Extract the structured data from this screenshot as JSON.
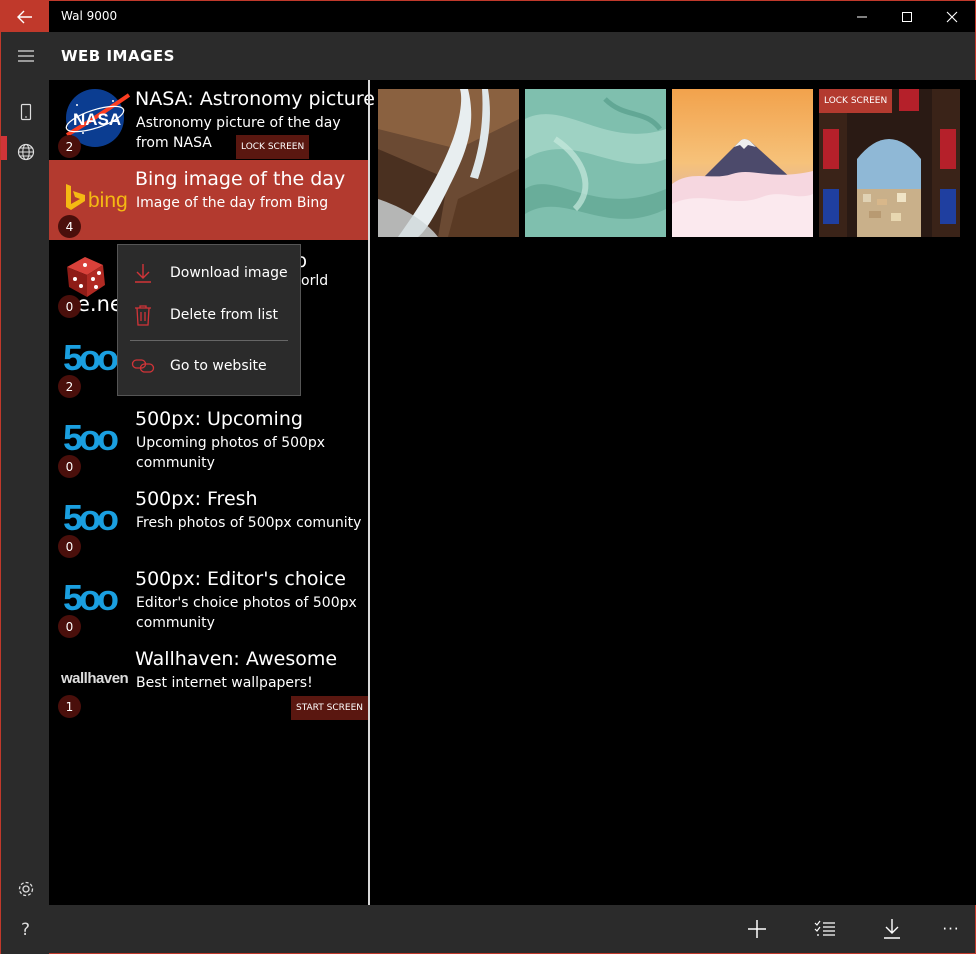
{
  "window": {
    "title": "Wal 9000"
  },
  "header": {
    "title": "WEB IMAGES"
  },
  "sources": [
    {
      "title": "NASA: Astronomy picture",
      "subtitle": "Astronomy picture of the day from NASA",
      "count": "2",
      "logo": "NASA"
    },
    {
      "title": "Bing image of the day",
      "subtitle": "Image of the day from Bing",
      "count": "4",
      "tag": "LOCK SCREEN",
      "logo": "bing",
      "selected": true
    },
    {
      "title_fragment": "p",
      "subtitle_fragment": "orld",
      "logo_fragment": "e.ne",
      "count": "0"
    },
    {
      "count": "2"
    },
    {
      "title": "500px: Upcoming",
      "subtitle": "Upcoming photos of 500px community",
      "count": "0",
      "logo": "500"
    },
    {
      "title": "500px: Fresh",
      "subtitle": "Fresh photos of 500px comunity",
      "count": "0",
      "logo": "500"
    },
    {
      "title": "500px: Editor's choice",
      "subtitle": "Editor's choice photos of 500px community",
      "count": "0",
      "logo": "500"
    },
    {
      "title": "Wallhaven: Awesome",
      "subtitle": "Best internet wallpapers!",
      "count": "1",
      "tag": "START SCREEN",
      "logo": "wallhaven"
    }
  ],
  "context_menu": {
    "items": [
      {
        "label": "Download image",
        "icon": "download-icon"
      },
      {
        "label": "Delete from list",
        "icon": "trash-icon"
      },
      {
        "label": "Go to website",
        "icon": "link-icon"
      }
    ]
  },
  "thumbnails": [
    {
      "name": "waterfall-rocks"
    },
    {
      "name": "teal-swirl"
    },
    {
      "name": "mount-fuji-clouds"
    },
    {
      "name": "arched-window-city",
      "tag": "LOCK SCREEN"
    }
  ],
  "appbar": {
    "icons": [
      "add-icon",
      "select-list-icon",
      "download-icon",
      "more-icon"
    ],
    "more_label": "···"
  },
  "rail": {
    "icons": [
      "hamburger-icon",
      "phone-icon",
      "globe-icon",
      "settings-icon",
      "help-icon"
    ],
    "help_label": "?"
  },
  "colors": {
    "accent": "#b33a2f",
    "chrome": "#2b2b2b",
    "badge": "#4a0f0b",
    "px500": "#1a9fe0",
    "bing": "#f5b913"
  }
}
